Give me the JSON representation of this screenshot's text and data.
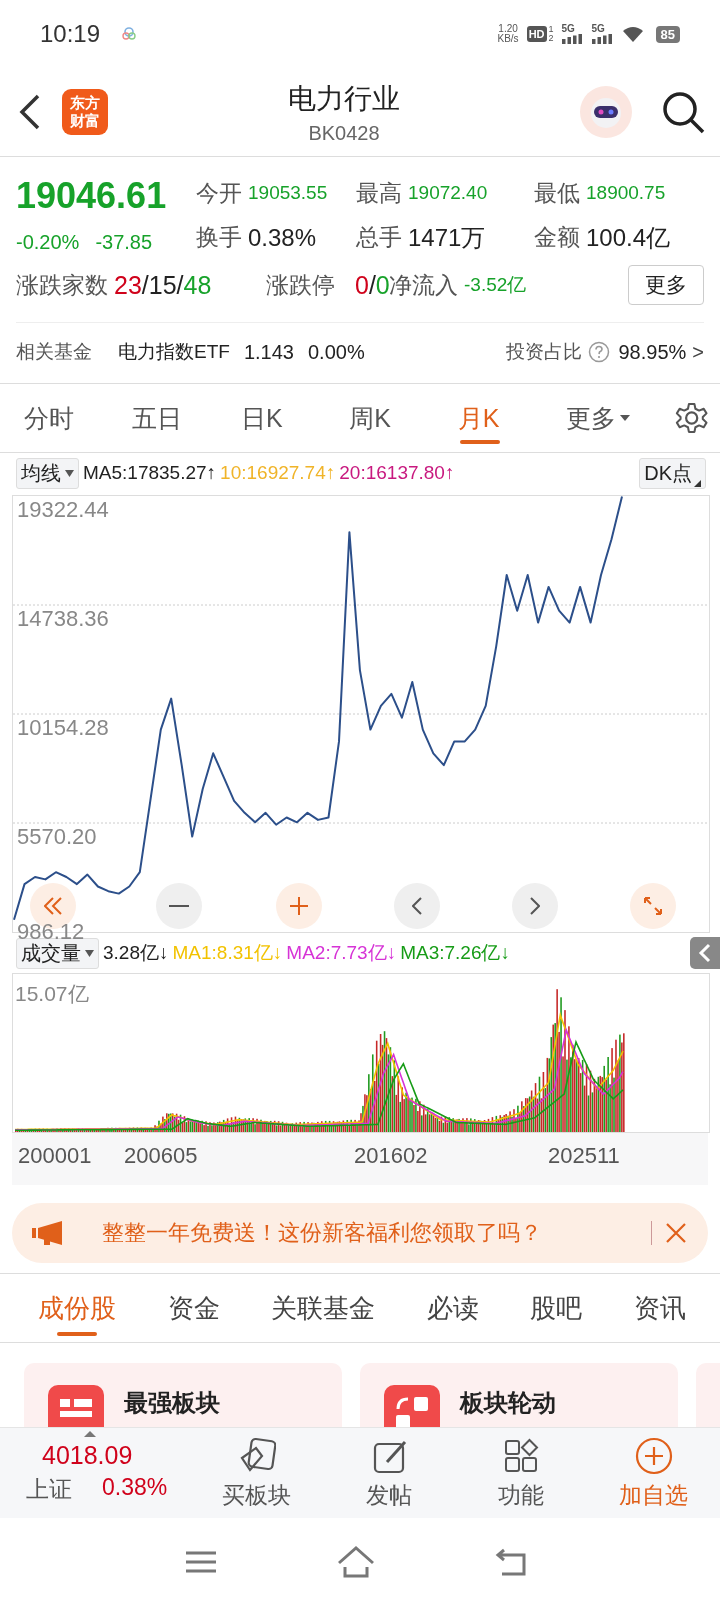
{
  "status_bar": {
    "time": "10:19",
    "net_speed": "1.20",
    "net_unit": "KB/s",
    "hd": "HD",
    "sim_slots": [
      "1",
      "2"
    ],
    "networks": [
      "5G",
      "5G"
    ],
    "battery": "85"
  },
  "header": {
    "logo": [
      "东方",
      "财富"
    ],
    "title": "电力行业",
    "code": "BK0428"
  },
  "quote": {
    "price": "19046.61",
    "change_pct": "-0.20%",
    "change": "-37.85",
    "color": "#17a22a",
    "stats": [
      {
        "label": "今开",
        "value": "19053.55",
        "color": "#17a22a"
      },
      {
        "label": "最高",
        "value": "19072.40",
        "color": "#17a22a"
      },
      {
        "label": "最低",
        "value": "18900.75",
        "color": "#17a22a"
      },
      {
        "label": "换手",
        "value": "0.38%",
        "color": "#222222"
      },
      {
        "label": "总手",
        "value": "1471万",
        "color": "#222222"
      },
      {
        "label": "金额",
        "value": "100.4亿",
        "color": "#222222"
      }
    ],
    "breadth": {
      "label": "涨跌家数",
      "separator": "/",
      "parts": [
        {
          "value": "23",
          "color": "#d0021b"
        },
        {
          "value": "15",
          "color": "#222222"
        },
        {
          "value": "48",
          "color": "#17a22a"
        }
      ]
    },
    "limit": {
      "label": "涨跌停",
      "separator": "/",
      "parts": [
        {
          "value": "0",
          "color": "#d0021b"
        },
        {
          "value": "0",
          "color": "#17a22a"
        }
      ]
    },
    "net_inflow": {
      "label": "净流入",
      "value": "-3.52亿",
      "color": "#17a22a"
    },
    "more_button": "更多"
  },
  "fund": {
    "label": "相关基金",
    "name": "电力指数ETF",
    "price": "1.143",
    "change": "0.00%",
    "ratio_label": "投资占比",
    "ratio": "98.95%",
    "arrow": ">"
  },
  "period_tabs": [
    {
      "label": "分时",
      "selected": false,
      "kind": "tab"
    },
    {
      "label": "五日",
      "selected": false,
      "kind": "tab"
    },
    {
      "label": "日K",
      "selected": false,
      "kind": "tab"
    },
    {
      "label": "周K",
      "selected": false,
      "kind": "tab"
    },
    {
      "label": "月K",
      "selected": true,
      "kind": "tab"
    },
    {
      "label": "更多",
      "selected": false,
      "kind": "dropdown"
    }
  ],
  "ma_legend": {
    "selector": "均线",
    "items": [
      {
        "text": "MA5:17835.27↑",
        "color": "#222222"
      },
      {
        "text": "10:16927.74↑",
        "color": "#f0b429"
      },
      {
        "text": "20:16137.80↑",
        "color": "#c8197f"
      }
    ],
    "dk_button": "DK点"
  },
  "price_chart": {
    "chart_data": {
      "type": "line",
      "grid": true,
      "ylim": [
        986.12,
        19322.44
      ],
      "yticks": [
        {
          "value": 19322.44,
          "label": "19322.44"
        },
        {
          "value": 14738.36,
          "label": "14738.36"
        },
        {
          "value": 10154.28,
          "label": "10154.28"
        },
        {
          "value": 5570.2,
          "label": "5570.20"
        },
        {
          "value": 986.12,
          "label": "986.12"
        }
      ],
      "series": [
        {
          "color": "#2c4f8a",
          "values": [
            1500,
            3000,
            3300,
            3200,
            3500,
            3300,
            3000,
            3400,
            2900,
            2700,
            2600,
            2900,
            3500,
            6500,
            9500,
            10800,
            8000,
            5000,
            7000,
            8500,
            7500,
            6500,
            6000,
            5600,
            6000,
            5500,
            5800,
            5600,
            6000,
            5700,
            5800,
            9000,
            17800,
            12000,
            9500,
            10500,
            11000,
            10000,
            11500,
            9500,
            8500,
            8000,
            9000,
            9000,
            9500,
            10500,
            13000,
            16000,
            14500,
            16000,
            14000,
            15500,
            14500,
            14000,
            15500,
            14000,
            16000,
            17500,
            19300
          ]
        }
      ]
    }
  },
  "volume_legend": {
    "selector": "成交量",
    "items": [
      {
        "text": "3.28亿↓",
        "color": "#222222"
      },
      {
        "text": "MA1:8.31亿↓",
        "color": "#f2c200"
      },
      {
        "text": "MA2:7.73亿↓",
        "color": "#d633d6"
      },
      {
        "text": "MA3:7.26亿↓",
        "color": "#179c17"
      }
    ]
  },
  "volume_chart": {
    "max_label": "15.07亿",
    "dates": [
      "200001",
      "200605",
      "201602",
      "202511"
    ]
  },
  "banner": {
    "text": "整整一年免费送！这份新客福利您领取了吗？"
  },
  "content_tabs": [
    {
      "label": "成份股",
      "selected": true
    },
    {
      "label": "资金",
      "selected": false
    },
    {
      "label": "关联基金",
      "selected": false
    },
    {
      "label": "必读",
      "selected": false
    },
    {
      "label": "股吧",
      "selected": false
    },
    {
      "label": "资讯",
      "selected": false
    }
  ],
  "cards": [
    {
      "title": "最强板块",
      "kind": "rank"
    },
    {
      "title": "板块轮动",
      "kind": "rotate"
    }
  ],
  "bottom_bar": {
    "index": {
      "value": "4018.09",
      "name": "上证",
      "change": "0.38%",
      "color": "#d0021b"
    },
    "actions": [
      {
        "label": "买板块",
        "kind": "buy",
        "accent": false
      },
      {
        "label": "发帖",
        "kind": "post",
        "accent": false
      },
      {
        "label": "功能",
        "kind": "apps",
        "accent": false
      },
      {
        "label": "加自选",
        "kind": "add",
        "accent": true
      }
    ]
  }
}
